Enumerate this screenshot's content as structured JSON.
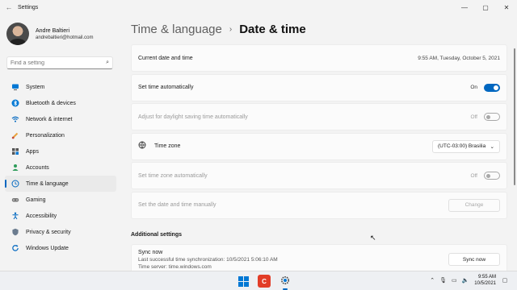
{
  "window": {
    "title": "Settings",
    "back_icon": "back-arrow-icon",
    "controls": [
      "minimize",
      "maximize",
      "close"
    ]
  },
  "user": {
    "name": "Andre Baltieri",
    "email": "andrebaltieri@hotmail.com"
  },
  "search": {
    "placeholder": "Find a setting"
  },
  "sidebar": {
    "items": [
      {
        "label": "System",
        "icon": "monitor-icon",
        "active": false
      },
      {
        "label": "Bluetooth & devices",
        "icon": "bluetooth-icon",
        "active": false
      },
      {
        "label": "Network & internet",
        "icon": "wifi-icon",
        "active": false
      },
      {
        "label": "Personalization",
        "icon": "brush-icon",
        "active": false
      },
      {
        "label": "Apps",
        "icon": "apps-icon",
        "active": false
      },
      {
        "label": "Accounts",
        "icon": "person-icon",
        "active": false
      },
      {
        "label": "Time & language",
        "icon": "globe-clock-icon",
        "active": true
      },
      {
        "label": "Gaming",
        "icon": "gamepad-icon",
        "active": false
      },
      {
        "label": "Accessibility",
        "icon": "accessibility-icon",
        "active": false
      },
      {
        "label": "Privacy & security",
        "icon": "shield-icon",
        "active": false
      },
      {
        "label": "Windows Update",
        "icon": "refresh-icon",
        "active": false
      }
    ]
  },
  "header": {
    "parent": "Time & language",
    "current": "Date & time"
  },
  "settings": {
    "current": {
      "label": "Current date and time",
      "value": "9:55 AM, Tuesday, October 5, 2021"
    },
    "auto_time": {
      "label": "Set time automatically",
      "state": "On"
    },
    "daylight": {
      "label": "Adjust for daylight saving time automatically",
      "state": "Off"
    },
    "timezone": {
      "label": "Time zone",
      "value": "(UTC-03:00) Brasilia"
    },
    "auto_tz": {
      "label": "Set time zone automatically",
      "state": "Off"
    },
    "manual": {
      "label": "Set the date and time manually",
      "button": "Change"
    }
  },
  "additional": {
    "title": "Additional settings",
    "sync": {
      "title": "Sync now",
      "last_sync": "Last successful time synchronization: 10/5/2021 5:06:10 AM",
      "server": "Time server: time.windows.com",
      "button": "Sync now"
    }
  },
  "taskbar": {
    "time": "9:55 AM",
    "date": "10/5/2021",
    "accent": "#0067c0"
  }
}
